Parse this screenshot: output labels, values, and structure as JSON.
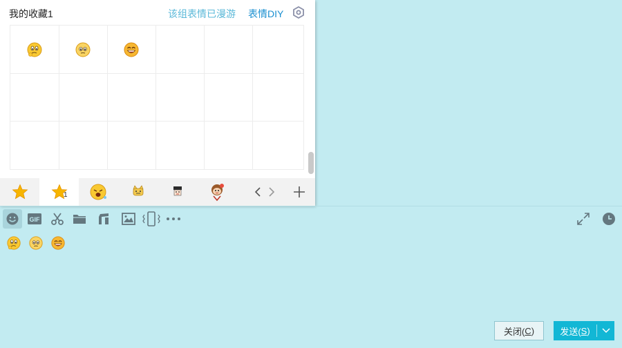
{
  "panel": {
    "title": "我的收藏1",
    "roam_text": "该组表情已漫游",
    "diy_text": "表情DIY",
    "grid_items": [
      "thinking-face",
      "pleading-face",
      "grinning-face"
    ],
    "tabs": [
      {
        "icon": "star-icon",
        "badge": ""
      },
      {
        "icon": "star-icon",
        "badge": "1"
      },
      {
        "icon": "crying-face-icon",
        "badge": ""
      },
      {
        "icon": "sticker-cat-icon",
        "badge": ""
      },
      {
        "icon": "sticker-character-icon",
        "badge": ""
      },
      {
        "icon": "sticker-monkey-icon",
        "badge": ""
      }
    ]
  },
  "toolbar": {
    "items": [
      "emoji-icon",
      "gif-icon",
      "scissors-icon",
      "folder-icon",
      "music-icon",
      "image-icon",
      "shake-icon",
      "more-icon"
    ],
    "right": [
      "expand-icon",
      "history-clock-icon"
    ]
  },
  "input": {
    "emojis": [
      "thinking-face",
      "pleading-face",
      "grinning-face"
    ]
  },
  "buttons": {
    "close_label": "关闭(",
    "close_key": "C",
    "close_end": ")",
    "send_label": "发送(",
    "send_key": "S",
    "send_end": ")"
  },
  "colors": {
    "background": "#c2ebf1",
    "send": "#12b7d5",
    "link": "#1a8fd0"
  }
}
